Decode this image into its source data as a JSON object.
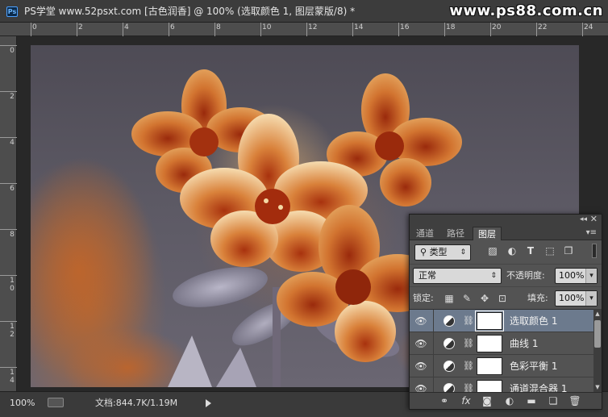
{
  "window": {
    "app_badge": "Ps",
    "title": "PS学堂 www.52psxt.com [古色润香] @ 100% (选取颜色 1, 图层蒙版/8) *",
    "watermark": "www.ps88.com.cn"
  },
  "rulers": {
    "horizontal_labels": [
      "0",
      "2",
      "4",
      "6",
      "8",
      "10",
      "12",
      "14",
      "16",
      "18",
      "20",
      "22",
      "24"
    ],
    "vertical_labels": [
      "0",
      "2",
      "4",
      "6",
      "8",
      "10",
      "12",
      "14"
    ]
  },
  "status": {
    "zoom": "100%",
    "doc_info": "文档:844.7K/1.19M"
  },
  "panel": {
    "collapse_glyph": "◂◂",
    "close_glyph": "✕",
    "menu_glyph": "▾≡",
    "tabs": [
      {
        "label": "通道",
        "active": false
      },
      {
        "label": "路径",
        "active": false
      },
      {
        "label": "图层",
        "active": true
      }
    ],
    "filter": {
      "kind_icon": "⚲",
      "kind_label": "类型"
    },
    "filter_icons": [
      "image-filter-icon",
      "adjustment-filter-icon",
      "type-filter-icon",
      "shape-filter-icon",
      "smart-object-filter-icon"
    ],
    "blend_mode": "正常",
    "opacity_label": "不透明度:",
    "opacity_value": "100%",
    "lock_label": "锁定:",
    "fill_label": "填充:",
    "fill_value": "100%",
    "layers": [
      {
        "name": "选取颜色 1",
        "selected": true,
        "visible": true
      },
      {
        "name": "曲线 1",
        "selected": false,
        "visible": true
      },
      {
        "name": "色彩平衡 1",
        "selected": false,
        "visible": true
      },
      {
        "name": "通道混合器 1",
        "selected": false,
        "visible": true
      }
    ],
    "bottom_icons": [
      "link-layers-icon",
      "fx-icon",
      "add-mask-icon",
      "new-adjustment-icon",
      "new-group-icon",
      "new-layer-icon",
      "trash-icon"
    ]
  }
}
